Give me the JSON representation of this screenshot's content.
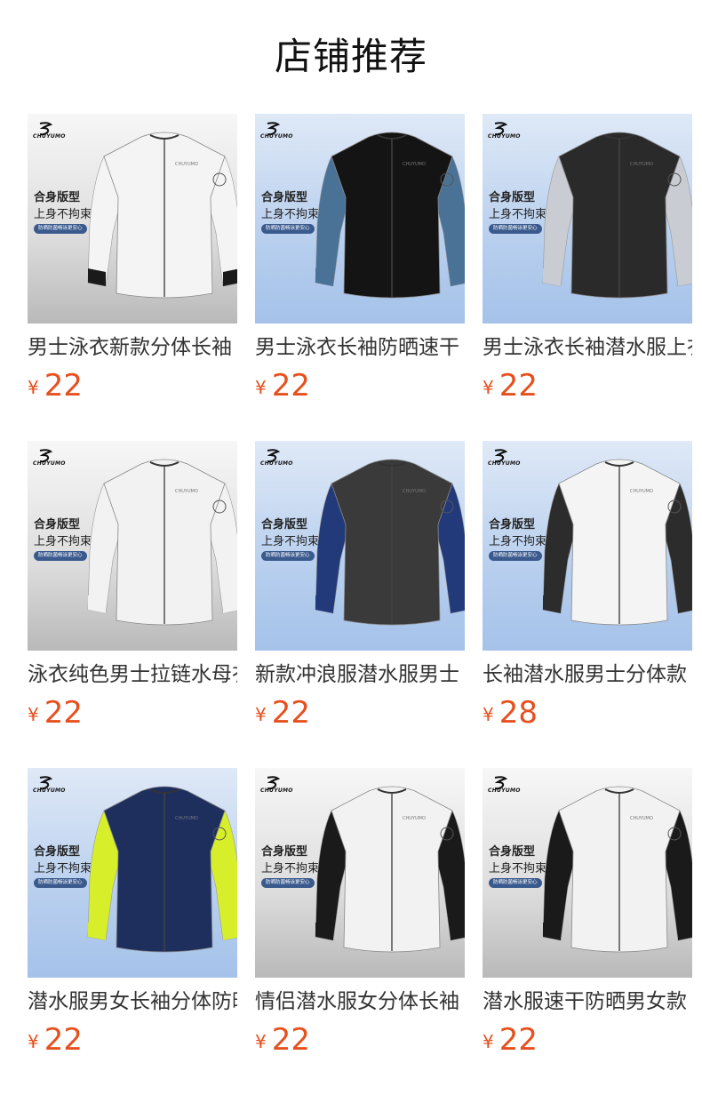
{
  "page": {
    "title": "店铺推荐"
  },
  "colors": {
    "price": "#e6501e",
    "pill": "#3a5a8e",
    "bg_blue": "#b8cfee",
    "bg_gray": "#dcdcdc"
  },
  "common": {
    "brand": "CHUYUMO",
    "tag1": "合身版型",
    "tag2": "上身不拘束",
    "pill": "防晒防菌畅泳更安心",
    "currency": "¥"
  },
  "products": [
    {
      "name": "男士泳衣新款分体长袖",
      "price": "22",
      "background": "gray",
      "body_color": "#f4f4f4",
      "sleeve_color": "#f4f4f4",
      "cuff_color": "#1a1a1a"
    },
    {
      "name": "男士泳衣长袖防晒速干",
      "price": "22",
      "background": "blue",
      "body_color": "#141414",
      "sleeve_color": "#4a7296",
      "cuff_color": "#4a7296"
    },
    {
      "name": "男士泳衣长袖潜水服上衣",
      "price": "22",
      "background": "blue",
      "body_color": "#2a2a2a",
      "sleeve_color": "#c9ccd2",
      "cuff_color": "#c9ccd2"
    },
    {
      "name": "泳衣纯色男士拉链水母衣",
      "price": "22",
      "background": "gray",
      "body_color": "#f2f2f2",
      "sleeve_color": "#f2f2f2",
      "cuff_color": "#f2f2f2"
    },
    {
      "name": "新款冲浪服潜水服男士",
      "price": "22",
      "background": "blue",
      "body_color": "#3a3a3a",
      "sleeve_color": "#233a7a",
      "cuff_color": "#233a7a"
    },
    {
      "name": "长袖潜水服男士分体款",
      "price": "28",
      "background": "blue",
      "body_color": "#f4f4f4",
      "sleeve_color": "#2c2c2c",
      "cuff_color": "#2c2c2c"
    },
    {
      "name": "潜水服男女长袖分体防晒",
      "price": "22",
      "background": "blue",
      "body_color": "#1e2f5e",
      "sleeve_color": "#d7ef2a",
      "cuff_color": "#d7ef2a"
    },
    {
      "name": "情侣潜水服女分体长袖",
      "price": "22",
      "background": "gray",
      "body_color": "#f2f2f2",
      "sleeve_color": "#1a1a1a",
      "cuff_color": "#1a1a1a"
    },
    {
      "name": "潜水服速干防晒男女款",
      "price": "22",
      "background": "gray",
      "body_color": "#f2f2f2",
      "sleeve_color": "#1a1a1a",
      "cuff_color": "#1a1a1a"
    }
  ]
}
